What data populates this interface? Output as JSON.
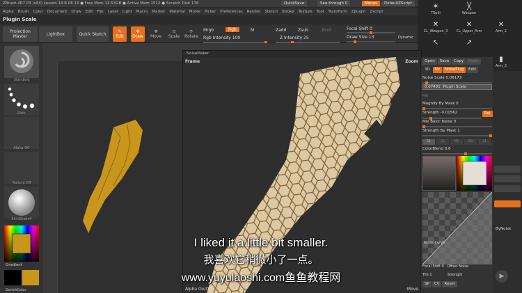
{
  "app": {
    "title": "ZBrush 4R7 P3 (x64)    Lesson 14 B 08 13  ● Free Mem 12.53GB ● Active Mem 1512 ● Scratch Disk 176",
    "quicksave": "QuickSave",
    "seethrough": "See-through  0",
    "menus": "Menus",
    "script": "DefaultZScript"
  },
  "menubar": [
    "Alpha",
    "Brush",
    "Color",
    "Document",
    "Draw",
    "Edit",
    "File",
    "Layer",
    "Light",
    "Macro",
    "Marker",
    "Material",
    "Movie",
    "Picker",
    "Preferences",
    "Render",
    "Stencil",
    "Stroke",
    "Texture",
    "Tool",
    "Transform",
    "Zplugin",
    "Zscript"
  ],
  "plugin_label": "Plugin Scale",
  "toolbar": {
    "projection_master": "Projection Master",
    "lightbox": "LightBox",
    "quick_sketch": "Quick Sketch",
    "edit": "Edit",
    "draw": "Draw",
    "move": "Move",
    "scale": "Scale",
    "rotate": "Rotate",
    "mrgb": "Mrgb",
    "rgb": "Rgb",
    "m": "M",
    "rgb_intensity": "Rgb Intensity 100",
    "zadd": "Zadd",
    "zsub": "Zsub",
    "zcut": "Zcut",
    "z_intensity": "Z Intensity 25",
    "focal_shift": "Focal Shift 0",
    "draw_size": "Draw Size 13",
    "dynamic": "Dynamic"
  },
  "brushes": [
    {
      "label": "TSpill",
      "sym": "✶"
    },
    {
      "label": "Weapon",
      "sym": "╳"
    },
    {
      "label": "CL_Weapon_3",
      "sym": "✕"
    },
    {
      "label": "CL_Upper_Arm",
      "sym": "✕"
    },
    {
      "label": "Arm_2",
      "sym": "✕"
    },
    {
      "label": "",
      "sym": "↖"
    },
    {
      "label": "",
      "sym": "↗"
    },
    {
      "label": "Arm_3",
      "sym": "▮"
    }
  ],
  "leftshelf": {
    "standard": "Standard",
    "dots": "Dots",
    "alpha_off": "Alpha Off",
    "texture_off": "Texture Off",
    "material": "SkinShade4",
    "gradient": "Gradient",
    "switch_color": "SwitchColor"
  },
  "noisemaker": {
    "title": "NoiseMaker",
    "frame": "Frame",
    "zoom": "Zoom",
    "alpha_onoff": "Alpha On/Off",
    "move": "Move"
  },
  "npanel": {
    "open": "Open",
    "save": "Save",
    "copy": "Copy",
    "paste": "Paste",
    "sd": "3D",
    "uv": "Uv",
    "noiseplug": "NoisePlug",
    "edit": "Edit",
    "noise_scale": "Noise Scale  0.06173",
    "plugin_scale_val": "0.07401",
    "plugin_scale": "Plugin Scale",
    "mag_by_mask": "Magnify By Mask 0",
    "strength": "Strength -0.01562",
    "rel": "Rel",
    "mix_basic": "Mix Basic Noise 0",
    "strength_by_mask": "Strength By Mask 1",
    "colorblend": "ColorBlend 0.6",
    "tabs": [
      "C1",
      "C2",
      "M1",
      "M2",
      "S1"
    ],
    "noise_curve": "Noise Curve",
    "focal_shift": "Focal Shift 0",
    "offset_noise": "Offset Noise",
    "tile": "Tile 1",
    "strength2": "Strength",
    "sp": "SP",
    "cv": "CV",
    "reset": "Reset"
  },
  "farright": {
    "bynoise": "ByNoise"
  },
  "subtitles": {
    "en": "I liked it a little bit smaller.",
    "cn": "我喜欢它稍微小了一点。",
    "url": "www.yuyulaoshi.com鱼鱼教程网"
  },
  "colors": {
    "accent": "#e8701c",
    "model": "#d8c6a2",
    "model_lines": "#8a7048",
    "gold": "#c9961c"
  }
}
